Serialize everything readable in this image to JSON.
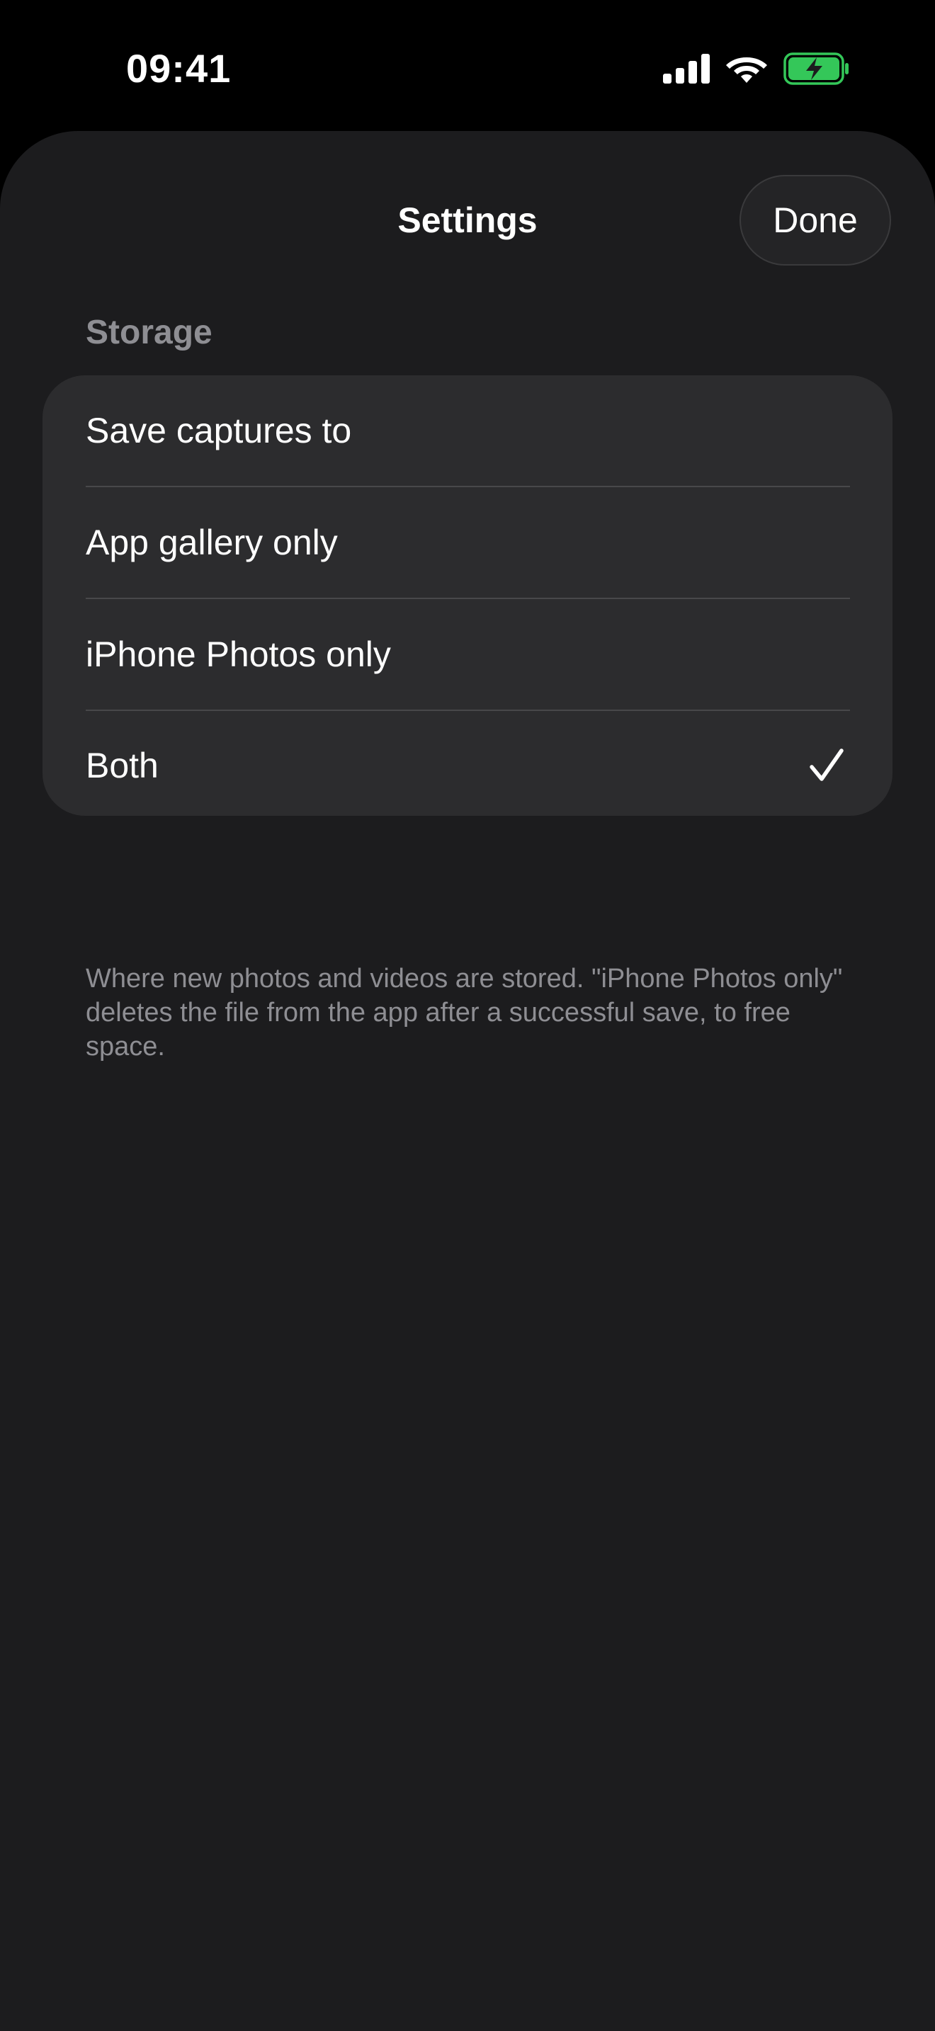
{
  "status_bar": {
    "time": "09:41",
    "icons": [
      "cellular-signal-icon",
      "wifi-icon",
      "battery-charging-icon"
    ],
    "battery_color": "#34c759"
  },
  "header": {
    "title": "Settings",
    "done_label": "Done"
  },
  "storage": {
    "section_title": "Storage",
    "picker_label": "Save captures to",
    "options": [
      {
        "label": "App gallery only",
        "selected": false
      },
      {
        "label": "iPhone Photos only",
        "selected": false
      },
      {
        "label": "Both",
        "selected": true
      }
    ],
    "footer": "Where new photos and videos are stored. \"iPhone Photos only\" deletes the file from the app after a successful save, to free space."
  },
  "colors": {
    "background": "#000000",
    "sheet": "#1c1c1e",
    "group": "#2c2c2e",
    "secondary_text": "#8e8e93"
  }
}
